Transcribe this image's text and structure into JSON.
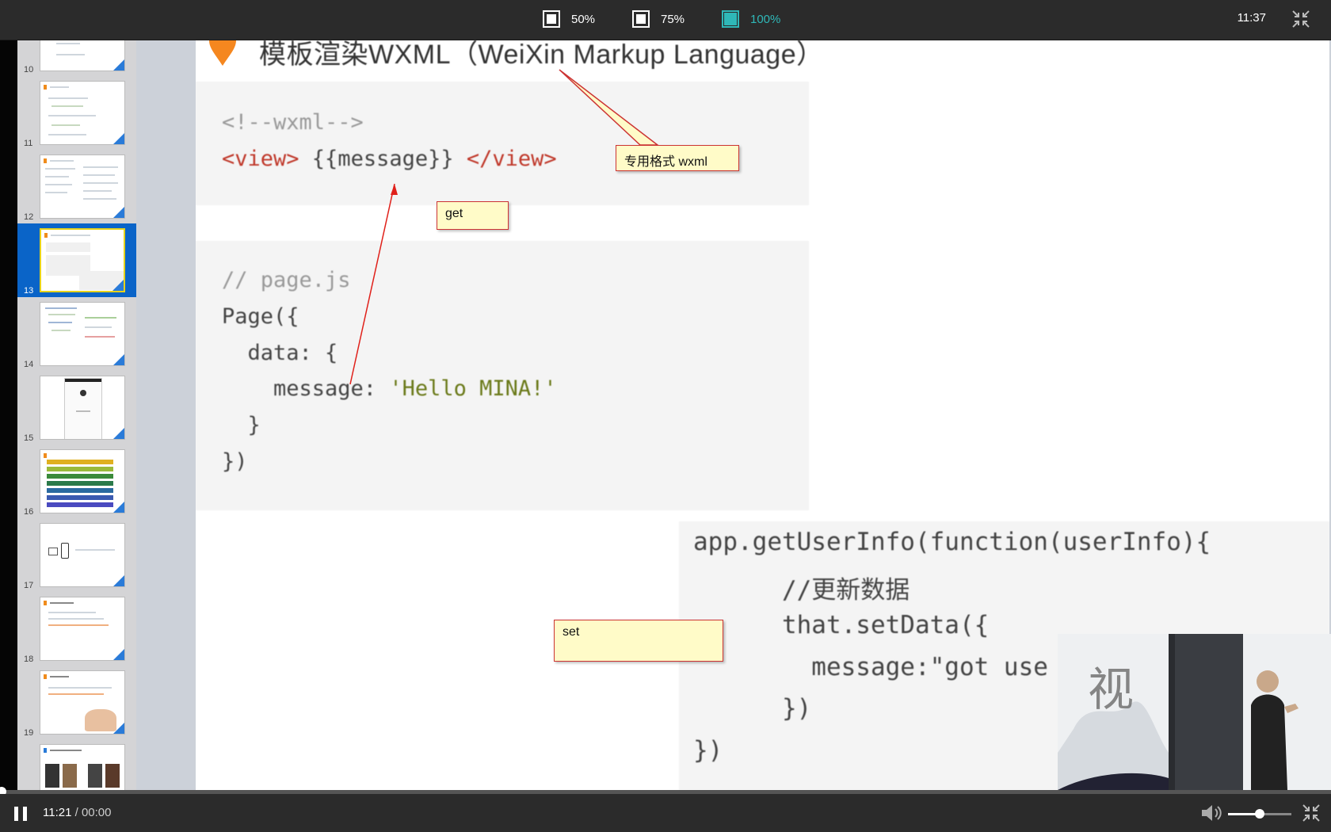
{
  "topbar": {
    "zoom_options": [
      {
        "label": "50%",
        "active": false
      },
      {
        "label": "75%",
        "active": false
      },
      {
        "label": "100%",
        "active": true
      }
    ],
    "clock": "11:37"
  },
  "thumbnails": [
    {
      "num": "10",
      "active": false
    },
    {
      "num": "11",
      "active": false
    },
    {
      "num": "12",
      "active": false
    },
    {
      "num": "13",
      "active": true
    },
    {
      "num": "14",
      "active": false
    },
    {
      "num": "15",
      "active": false
    },
    {
      "num": "16",
      "active": false
    },
    {
      "num": "17",
      "active": false
    },
    {
      "num": "18",
      "active": false
    },
    {
      "num": "19",
      "active": false
    }
  ],
  "slide": {
    "title": "模板渲染WXML（WeiXin Markup Language）",
    "code1": {
      "line1": "<!--wxml-->",
      "line2_tag_open": "<view>",
      "line2_expr": " {{message}} ",
      "line2_tag_close": "</view>"
    },
    "code2": {
      "line1": "// page.js",
      "line2": "Page({",
      "line3": "  data: {",
      "line4_key": "    message: ",
      "line4_val": "'Hello MINA!'",
      "line5": "  }",
      "line6": "})"
    },
    "code3": {
      "line1": "app.getUserInfo(function(userInfo){",
      "line2": "      //更新数据",
      "line3": "      that.setData({",
      "line4": "        message:\"got use",
      "line5": "      })",
      "line6": "})"
    }
  },
  "callouts": {
    "wxml": "专用格式 wxml",
    "get": "get",
    "set": "set"
  },
  "player": {
    "elapsed": "11:21",
    "separator": " / ",
    "total": "00:00",
    "volume_level": 0.5,
    "progress": 0.0
  },
  "colors": {
    "accent": "#2fb8b8",
    "active_thumb": "#0a64c8",
    "callout_bg": "#fffbc8",
    "arrow": "#e0201a"
  }
}
